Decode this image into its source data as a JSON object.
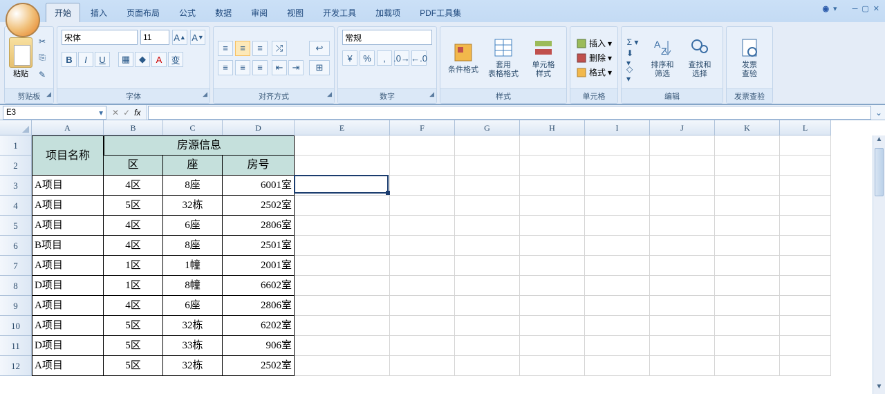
{
  "tabs": [
    "开始",
    "插入",
    "页面布局",
    "公式",
    "数据",
    "审阅",
    "视图",
    "开发工具",
    "加载项",
    "PDF工具集"
  ],
  "active_tab": 0,
  "ribbon": {
    "clipboard": {
      "label": "剪贴板",
      "paste": "粘贴"
    },
    "font": {
      "label": "字体",
      "name": "宋体",
      "size": "11"
    },
    "align": {
      "label": "对齐方式"
    },
    "number": {
      "label": "数字",
      "format": "常规"
    },
    "styles": {
      "label": "样式",
      "cond": "条件格式",
      "table": "套用\n表格格式",
      "cell": "单元格\n样式"
    },
    "cells": {
      "label": "单元格",
      "insert": "插入",
      "delete": "删除",
      "format": "格式"
    },
    "editing": {
      "label": "编辑",
      "sort": "排序和\n筛选",
      "find": "查找和\n选择"
    },
    "invoice": {
      "label": "发票查验",
      "btn": "发票\n查验"
    }
  },
  "formula_bar": {
    "cell_ref": "E3",
    "fx": "fx",
    "value": ""
  },
  "columns": [
    {
      "l": "A",
      "w": 104
    },
    {
      "l": "B",
      "w": 86
    },
    {
      "l": "C",
      "w": 86
    },
    {
      "l": "D",
      "w": 104
    },
    {
      "l": "E",
      "w": 138
    },
    {
      "l": "F",
      "w": 94
    },
    {
      "l": "G",
      "w": 94
    },
    {
      "l": "H",
      "w": 94
    },
    {
      "l": "I",
      "w": 94
    },
    {
      "l": "J",
      "w": 94
    },
    {
      "l": "K",
      "w": 94
    },
    {
      "l": "L",
      "w": 74
    }
  ],
  "row_nums": [
    1,
    2,
    3,
    4,
    5,
    6,
    7,
    8,
    9,
    10,
    11,
    12
  ],
  "table": {
    "header1": {
      "project": "项目名称",
      "info": "房源信息"
    },
    "header2": [
      "区",
      "座",
      "房号"
    ],
    "rows": [
      [
        "A项目",
        "4区",
        "8座",
        "6001室"
      ],
      [
        "A项目",
        "5区",
        "32栋",
        "2502室"
      ],
      [
        "A项目",
        "4区",
        "6座",
        "2806室"
      ],
      [
        "B项目",
        "4区",
        "8座",
        "2501室"
      ],
      [
        "A项目",
        "1区",
        "1幢",
        "2001室"
      ],
      [
        "D项目",
        "1区",
        "8幢",
        "6602室"
      ],
      [
        "A项目",
        "4区",
        "6座",
        "2806室"
      ],
      [
        "A项目",
        "5区",
        "32栋",
        "6202室"
      ],
      [
        "D项目",
        "5区",
        "33栋",
        "906室"
      ],
      [
        "A项目",
        "5区",
        "32栋",
        "2502室"
      ]
    ]
  },
  "active": {
    "col": 4,
    "row": 2
  }
}
